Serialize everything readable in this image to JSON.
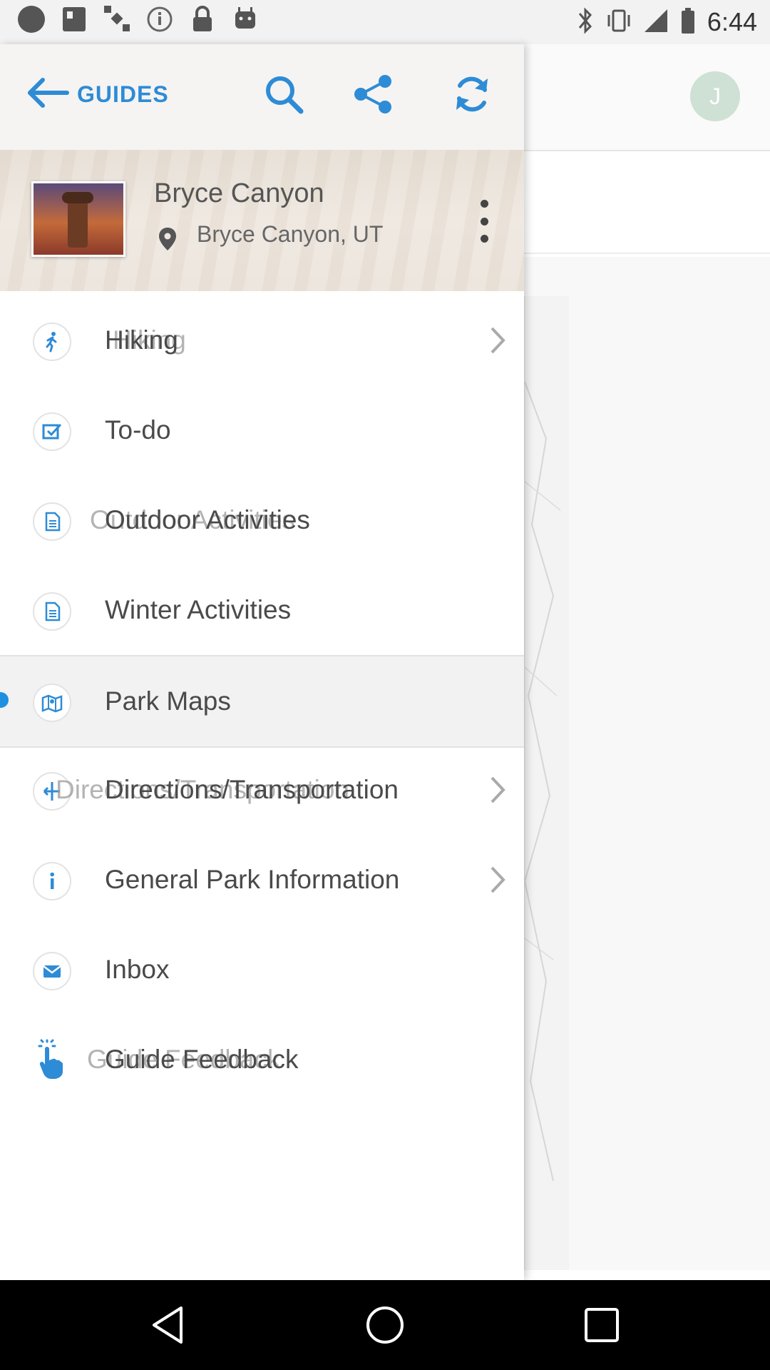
{
  "status_bar": {
    "time": "6:44",
    "left_icons": [
      "circle-icon",
      "fake-gps-icon",
      "satellite-icon",
      "info-icon",
      "lock-icon",
      "android-icon"
    ],
    "right_icons": [
      "bluetooth-icon",
      "vibrate-icon",
      "signal-icon",
      "battery-icon"
    ]
  },
  "background": {
    "avatar_initial": "J"
  },
  "drawer": {
    "back_label": "GUIDES",
    "toolbar_icons": [
      "search-icon",
      "share-icon",
      "refresh-icon"
    ],
    "guide": {
      "title": "Bryce Canyon",
      "location": "Bryce Canyon, UT"
    },
    "items": [
      {
        "label": "Hiking",
        "ghost": "Hiking",
        "icon": "hiking-icon",
        "has_chevron": true
      },
      {
        "label": "To-do",
        "icon": "checkbox-icon",
        "has_chevron": false
      },
      {
        "label": "Outdoor Activities",
        "ghost": "Outdoor Activities",
        "icon": "document-icon",
        "has_chevron": false
      },
      {
        "label": "Winter Activities",
        "icon": "document-icon",
        "has_chevron": false
      },
      {
        "label": "Park Maps",
        "icon": "map-icon",
        "has_chevron": false,
        "active": true
      },
      {
        "label": "Directions/Transportation",
        "ghost": "Directions/Transportation",
        "icon": "directions-icon",
        "has_chevron": true
      },
      {
        "label": "General Park Information",
        "icon": "info-icon",
        "has_chevron": true
      },
      {
        "label": "Inbox",
        "icon": "mail-icon",
        "has_chevron": false
      },
      {
        "label": "Guide Feedback",
        "ghost": "Guide Feedback",
        "icon": "tap-icon",
        "has_chevron": false
      }
    ]
  },
  "colors": {
    "accent": "#2e8bd6",
    "active_dot": "#1f8fe0"
  }
}
